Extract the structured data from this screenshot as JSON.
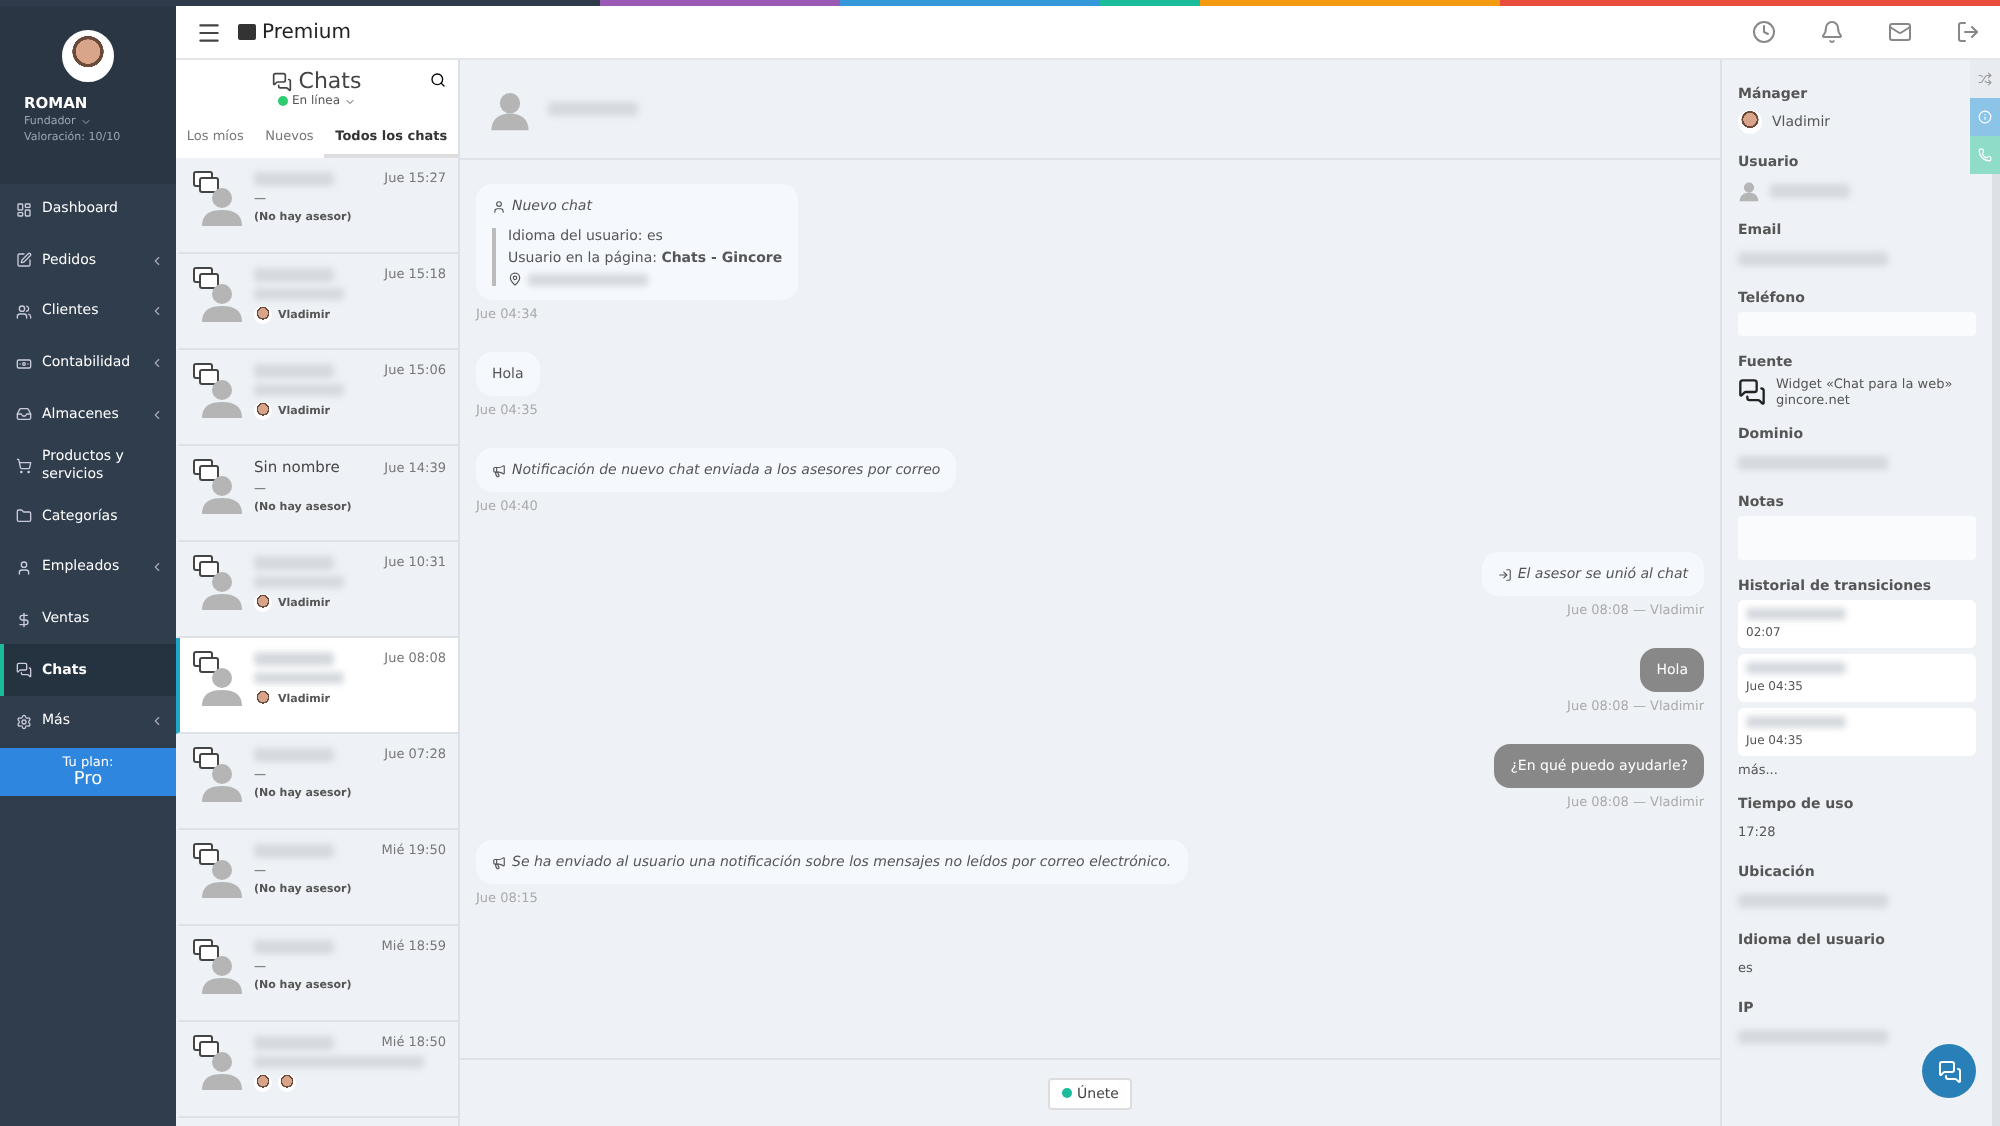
{
  "profile": {
    "name": "ROMAN",
    "role": "Fundador",
    "rating": "Valoración: 10/10"
  },
  "menu": [
    {
      "label": "Dashboard",
      "expandable": false,
      "selected": false
    },
    {
      "label": "Pedidos",
      "expandable": true,
      "selected": false
    },
    {
      "label": "Clientes",
      "expandable": true,
      "selected": false
    },
    {
      "label": "Contabilidad",
      "expandable": true,
      "selected": false
    },
    {
      "label": "Almacenes",
      "expandable": true,
      "selected": false
    },
    {
      "label": "Productos y servicios",
      "expandable": false,
      "selected": false
    },
    {
      "label": "Categorías",
      "expandable": false,
      "selected": false
    },
    {
      "label": "Empleados",
      "expandable": true,
      "selected": false
    },
    {
      "label": "Ventas",
      "expandable": false,
      "selected": false
    },
    {
      "label": "Chats",
      "expandable": false,
      "selected": true
    },
    {
      "label": "Más",
      "expandable": true,
      "selected": false
    }
  ],
  "plan": {
    "label": "Tu plan:",
    "value": "Pro"
  },
  "header": {
    "brand": "Premium"
  },
  "chat_list": {
    "title": "Chats",
    "status": "En línea",
    "tabs": [
      {
        "label": "Los míos",
        "selected": false
      },
      {
        "label": "Nuevos",
        "selected": false
      },
      {
        "label": "Todos los chats",
        "selected": true
      }
    ],
    "items": [
      {
        "time": "Jue 15:27",
        "preview": "—",
        "advisor": "(No hay asesor)",
        "kind": "unassigned",
        "selected": false
      },
      {
        "time": "Jue 15:18",
        "advisor": "Vladimir",
        "kind": "assigned",
        "selected": false
      },
      {
        "time": "Jue 15:06",
        "advisor": "Vladimir",
        "kind": "assigned",
        "selected": false
      },
      {
        "name": "Sin nombre",
        "time": "Jue 14:39",
        "preview": "—",
        "advisor": "(No hay asesor)",
        "kind": "unassigned",
        "selected": false
      },
      {
        "time": "Jue 10:31",
        "advisor": "Vladimir",
        "kind": "assigned",
        "selected": false
      },
      {
        "time": "Jue 08:08",
        "advisor": "Vladimir",
        "kind": "assigned",
        "selected": true
      },
      {
        "time": "Jue 07:28",
        "preview": "—",
        "advisor": "(No hay asesor)",
        "kind": "unassigned",
        "selected": false
      },
      {
        "time": "Mié 19:50",
        "preview": "—",
        "advisor": "(No hay asesor)",
        "kind": "unassigned",
        "selected": false
      },
      {
        "time": "Mié 18:59",
        "preview": "—",
        "advisor": "(No hay asesor)",
        "kind": "unassigned",
        "selected": false
      },
      {
        "time": "Mié 18:50",
        "kind": "multi",
        "selected": false
      }
    ]
  },
  "messages": [
    {
      "kind": "info",
      "title": "Nuevo chat",
      "lines": [
        "Idioma del usuario: es",
        "Usuario en la página: **Chats - Gincore**"
      ],
      "meta": "Jue 04:34"
    },
    {
      "kind": "incoming",
      "text": "Hola",
      "meta": "Jue 04:35"
    },
    {
      "kind": "system",
      "text": "Notificación de nuevo chat enviada a los asesores por correo",
      "meta": "Jue 04:40"
    },
    {
      "kind": "joined",
      "text": "El asesor se unió al chat",
      "meta": "Jue 08:08 — Vladimir"
    },
    {
      "kind": "outgoing",
      "text": "Hola",
      "meta": "Jue 08:08 — Vladimir"
    },
    {
      "kind": "outgoing",
      "text": "¿En qué puedo ayudarle?",
      "meta": "Jue 08:08 — Vladimir"
    },
    {
      "kind": "system",
      "text": "Se ha enviado al usuario una notificación sobre los mensajes no leídos por correo electrónico.",
      "meta": "Jue 08:15"
    }
  ],
  "join_button": "Únete",
  "details": [
    {
      "label": "Mánager",
      "kind": "manager",
      "value": "Vladimir"
    },
    {
      "label": "Usuario",
      "kind": "user"
    },
    {
      "label": "Email",
      "kind": "blurred"
    },
    {
      "label": "Teléfono",
      "kind": "field"
    },
    {
      "label": "Fuente",
      "kind": "source",
      "value": "Widget «Chat para la web»",
      "sub": "gincore.net"
    },
    {
      "label": "Dominio",
      "kind": "blurred"
    },
    {
      "label": "Notas",
      "kind": "notes"
    },
    {
      "label": "Historial de transiciones",
      "kind": "history",
      "entries": [
        "02:07",
        "Jue 04:35",
        "Jue 04:35"
      ],
      "more": "más..."
    },
    {
      "label": "Tiempo de uso",
      "kind": "text",
      "value": "17:28"
    },
    {
      "label": "Ubicación",
      "kind": "blurred"
    },
    {
      "label": "Idioma del usuario",
      "kind": "text",
      "value": "es"
    },
    {
      "label": "IP",
      "kind": "blurred"
    }
  ]
}
